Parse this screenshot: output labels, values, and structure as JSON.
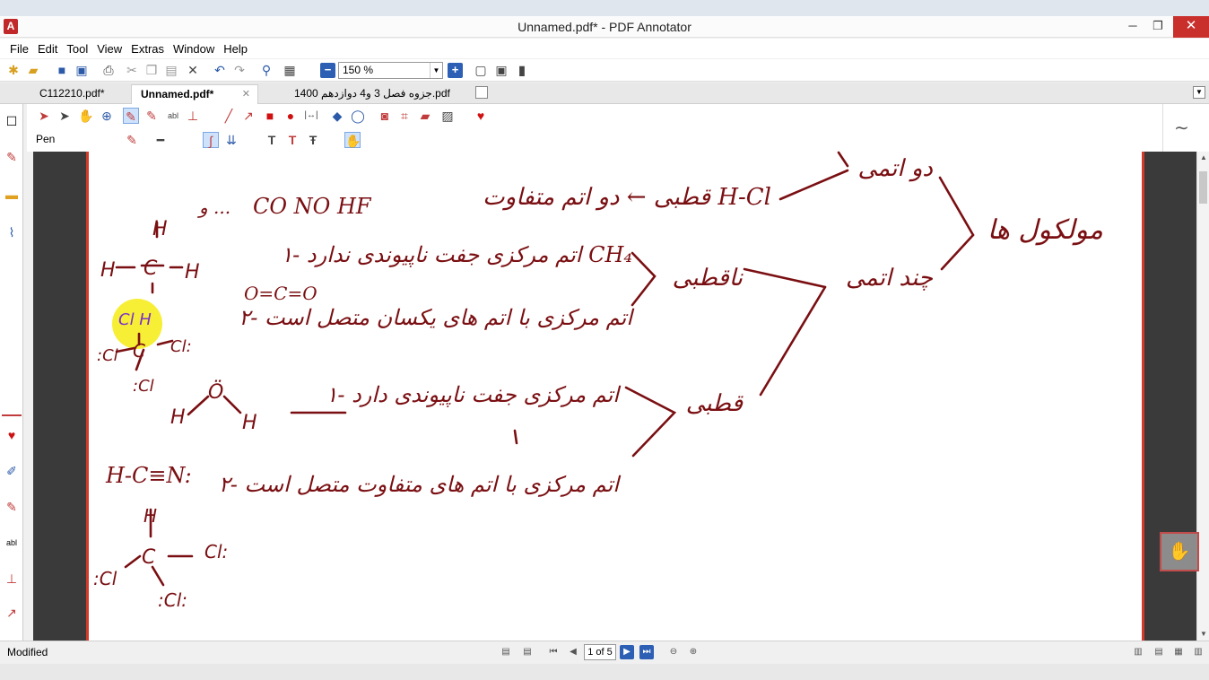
{
  "window": {
    "title": "Unnamed.pdf* - PDF Annotator",
    "min_label": "─",
    "max_label": "❐",
    "close_label": "✕"
  },
  "menu": [
    "File",
    "Edit",
    "Tool",
    "View",
    "Extras",
    "Window",
    "Help"
  ],
  "toolbar": {
    "zoom_value": "150 %"
  },
  "tabs": [
    {
      "label": "C112210.pdf*"
    },
    {
      "label": "Unnamed.pdf*",
      "active": true
    },
    {
      "label": "جزوه فصل 3 و4 دوازدهم 1400.pdf"
    }
  ],
  "annotation_toolbar": {
    "tool_name": "Pen"
  },
  "status": {
    "left_text": "Modified",
    "page_indicator": "1 of 5"
  },
  "colors": {
    "ink": "#7a0f12",
    "accent": "#d43a2a",
    "highlight": "#f7ee2a",
    "purple_ink": "#7b2fc9"
  },
  "ink_text": {
    "line1_right": "قطبی ← دو اتم متفاوت H-Cl",
    "line1_left": "CO  NO  HF",
    "line1_prefix": "و ...",
    "branch_top": "دو اتمی",
    "branch_mid": "چند اتمی",
    "branch_root": "مولکول ها",
    "nonpolar": "ناقطبی",
    "polar": "قطبی",
    "np1": "۱- اتم مرکزی جفت ناپیوندی ندارد CH₄",
    "np2": "۲- اتم مرکزی با اتم های یکسان متصل است",
    "p1": "۱- اتم مرکزی جفت ناپیوندی دارد",
    "p2": "۲- اتم مرکزی با اتم های متفاوت متصل است",
    "co2": "O=C=O",
    "hcn": "H-C≡N:"
  }
}
